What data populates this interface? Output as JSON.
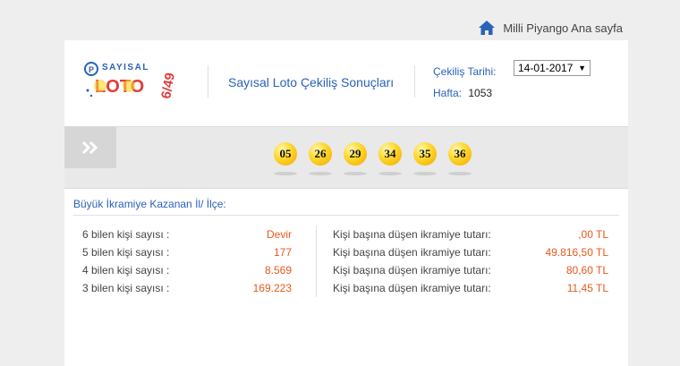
{
  "top_nav": {
    "home_label": "Milli Piyango Ana sayfa"
  },
  "header": {
    "title": "Sayısal Loto Çekiliş Sonuçları",
    "date_label": "Çekiliş Tarihi:",
    "date_value": "14-01-2017",
    "week_label": "Hafta:",
    "week_value": "1053",
    "logo": {
      "brand": "SAYISAL",
      "name": "LOTO",
      "format": "6/49"
    }
  },
  "draw": {
    "numbers": [
      "05",
      "26",
      "29",
      "34",
      "35",
      "36"
    ]
  },
  "results": {
    "section_title": "Büyük İkramiye Kazanan İl/ İlçe:",
    "rows": [
      {
        "label": "6 bilen kişi sayısı :",
        "count": "Devir",
        "prize_label": "Kişi başına düşen ikramiye tutarı:",
        "prize": ",00 TL"
      },
      {
        "label": "5 bilen kişi sayısı :",
        "count": "177",
        "prize_label": "Kişi başına düşen ikramiye tutarı:",
        "prize": "49.816,50 TL"
      },
      {
        "label": "4 bilen kişi sayısı :",
        "count": "8.569",
        "prize_label": "Kişi başına düşen ikramiye tutarı:",
        "prize": "80,60 TL"
      },
      {
        "label": "3 bilen kişi sayısı :",
        "count": "169.223",
        "prize_label": "Kişi başına düşen ikramiye tutarı:",
        "prize": "11,45 TL"
      }
    ]
  },
  "colors": {
    "accent_blue": "#2a62b8",
    "value_orange": "#e8591a",
    "ball_yellow": "#ffd626"
  }
}
